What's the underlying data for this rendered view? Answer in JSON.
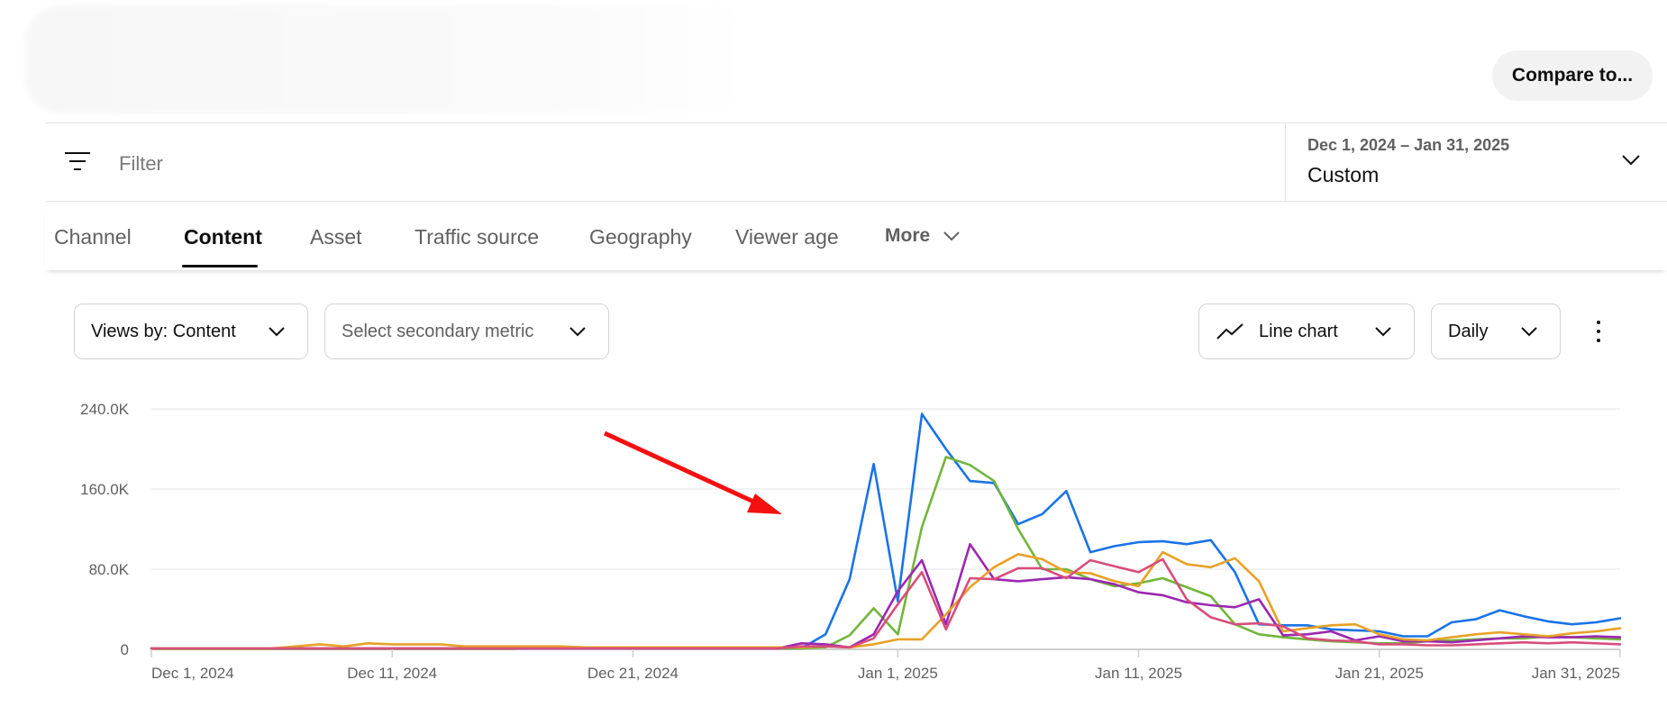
{
  "header": {
    "compare_label": "Compare to..."
  },
  "filter": {
    "placeholder": "Filter",
    "date_range": "Dec 1, 2024 – Jan 31, 2025",
    "date_preset": "Custom"
  },
  "tabs": [
    {
      "label": "Channel"
    },
    {
      "label": "Content",
      "active": true
    },
    {
      "label": "Asset"
    },
    {
      "label": "Traffic source"
    },
    {
      "label": "Geography"
    },
    {
      "label": "Viewer age"
    },
    {
      "label": "More"
    }
  ],
  "controls": {
    "metric": "Views by: Content",
    "secondary_metric": "Select secondary metric",
    "chart_type": "Line chart",
    "interval": "Daily",
    "chart_type_icon": "trending-line-icon",
    "menu_icon": "vertical-dots-icon"
  },
  "annotation": {
    "type": "red arrow",
    "color": "#f51010"
  },
  "chart_data": {
    "type": "line",
    "xlabel": "",
    "ylabel": "",
    "ylim": [
      0,
      240000
    ],
    "yticks": [
      0,
      80000,
      160000,
      240000
    ],
    "ytick_labels": [
      "0",
      "80.0K",
      "160.0K",
      "240.0K"
    ],
    "xtick_labels": [
      "Dec 1, 2024",
      "Dec 11, 2024",
      "Dec 21, 2024",
      "Jan 1, 2025",
      "Jan 11, 2025",
      "Jan 21, 2025",
      "Jan 31, 2025"
    ],
    "xtick_index": [
      0,
      10,
      20,
      31,
      41,
      51,
      61
    ],
    "grid": true,
    "legend": "none",
    "x": [
      "Dec 1",
      "Dec 2",
      "Dec 3",
      "Dec 4",
      "Dec 5",
      "Dec 6",
      "Dec 7",
      "Dec 8",
      "Dec 9",
      "Dec 10",
      "Dec 11",
      "Dec 12",
      "Dec 13",
      "Dec 14",
      "Dec 15",
      "Dec 16",
      "Dec 17",
      "Dec 18",
      "Dec 19",
      "Dec 20",
      "Dec 21",
      "Dec 22",
      "Dec 23",
      "Dec 24",
      "Dec 25",
      "Dec 26",
      "Dec 27",
      "Dec 28",
      "Dec 29",
      "Dec 30",
      "Dec 31",
      "Jan 1",
      "Jan 2",
      "Jan 3",
      "Jan 4",
      "Jan 5",
      "Jan 6",
      "Jan 7",
      "Jan 8",
      "Jan 9",
      "Jan 10",
      "Jan 11",
      "Jan 12",
      "Jan 13",
      "Jan 14",
      "Jan 15",
      "Jan 16",
      "Jan 17",
      "Jan 18",
      "Jan 19",
      "Jan 20",
      "Jan 21",
      "Jan 22",
      "Jan 23",
      "Jan 24",
      "Jan 25",
      "Jan 26",
      "Jan 27",
      "Jan 28",
      "Jan 29",
      "Jan 30",
      "Jan 31"
    ],
    "series": [
      {
        "color": "#1a73e8",
        "values": [
          1000,
          1000,
          1000,
          1000,
          1000,
          1000,
          1000,
          1000,
          1000,
          1000,
          1000,
          1000,
          1000,
          1000,
          1000,
          1000,
          1000,
          1000,
          1000,
          1000,
          1000,
          1000,
          1000,
          1000,
          1000,
          1000,
          1000,
          1000,
          15000,
          70000,
          185000,
          48000,
          235000,
          200000,
          168000,
          166000,
          125000,
          135000,
          158000,
          97000,
          103000,
          107000,
          108000,
          105000,
          109000,
          77000,
          25000,
          24000,
          24000,
          20000,
          19000,
          18000,
          13000,
          13000,
          27000,
          30000,
          39000,
          33000,
          28000,
          25000,
          27000,
          31000
        ]
      },
      {
        "color": "#72b53b",
        "values": [
          500,
          500,
          500,
          500,
          500,
          500,
          500,
          500,
          500,
          500,
          500,
          500,
          500,
          500,
          500,
          500,
          1500,
          2000,
          2000,
          1500,
          1000,
          1000,
          1000,
          1000,
          1000,
          1000,
          1000,
          1000,
          2000,
          14000,
          41000,
          15000,
          122000,
          192000,
          184000,
          168000,
          120000,
          80000,
          80000,
          70000,
          63000,
          66000,
          71000,
          62000,
          53000,
          25000,
          15000,
          12000,
          10000,
          8000,
          7000,
          6000,
          6000,
          8000,
          9000,
          10000,
          11000,
          11000,
          13000,
          12000,
          11000,
          10000
        ]
      },
      {
        "color": "#9c27b0",
        "values": [
          1000,
          1000,
          1000,
          1000,
          1000,
          1000,
          1000,
          1000,
          1000,
          1000,
          1000,
          1000,
          1000,
          1000,
          1000,
          1000,
          1000,
          1000,
          1000,
          1000,
          1000,
          1000,
          1000,
          1000,
          1000,
          1000,
          1000,
          6000,
          5000,
          2000,
          15000,
          58000,
          89000,
          25000,
          105000,
          70000,
          68000,
          70000,
          72000,
          70000,
          65000,
          57000,
          54000,
          47000,
          44000,
          42000,
          50000,
          14000,
          15000,
          18000,
          9000,
          13000,
          8000,
          8000,
          7000,
          9000,
          11000,
          13000,
          12000,
          12000,
          13000,
          12000
        ]
      },
      {
        "color": "#e8a125",
        "values": [
          1000,
          1000,
          1000,
          1000,
          1000,
          1000,
          3000,
          5000,
          3000,
          6000,
          5000,
          5000,
          5000,
          3000,
          3000,
          3000,
          3000,
          3000,
          2000,
          2000,
          2000,
          2000,
          2000,
          2000,
          2000,
          2000,
          2000,
          2000,
          3000,
          2000,
          5000,
          10000,
          10000,
          35000,
          62000,
          82000,
          95000,
          90000,
          77000,
          76000,
          68000,
          63000,
          97000,
          85000,
          82000,
          91000,
          68000,
          18000,
          21000,
          24000,
          25000,
          15000,
          10000,
          9000,
          12000,
          15000,
          17000,
          15000,
          13000,
          16000,
          18000,
          21000
        ]
      },
      {
        "color": "#d84d7c",
        "values": [
          1000,
          1000,
          1000,
          1000,
          1000,
          1000,
          1000,
          1000,
          1000,
          1000,
          1000,
          1000,
          1000,
          1000,
          1000,
          1000,
          1000,
          1000,
          1000,
          1000,
          1000,
          1000,
          1000,
          1000,
          1000,
          1000,
          1000,
          3000,
          3000,
          2000,
          11000,
          45000,
          77000,
          20000,
          71000,
          70000,
          81000,
          81000,
          71000,
          89000,
          83000,
          77000,
          90000,
          50000,
          32000,
          25000,
          26000,
          23000,
          11000,
          9000,
          8000,
          5000,
          5000,
          4000,
          4000,
          5000,
          6000,
          7000,
          6000,
          7000,
          6000,
          5000
        ]
      }
    ]
  }
}
